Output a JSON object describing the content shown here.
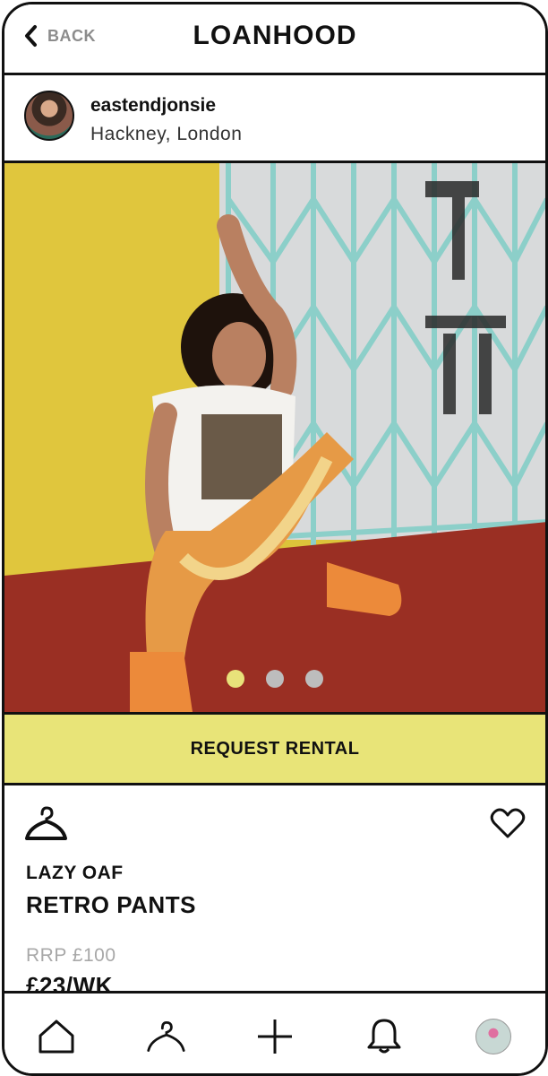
{
  "header": {
    "back_label": "BACK",
    "brand": "LOANHOOD"
  },
  "profile": {
    "username": "eastendjonsie",
    "location": "Hackney, London"
  },
  "gallery": {
    "image_count": 3,
    "active_index": 0
  },
  "actions": {
    "request_label": "REQUEST RENTAL"
  },
  "item": {
    "brand": "LAZY OAF",
    "name": "RETRO PANTS",
    "rrp": "RRP £100",
    "price": "£23/WK"
  },
  "bottom_nav": {
    "items": [
      "home-icon",
      "hanger-icon",
      "plus-icon",
      "bell-icon",
      "profile-avatar"
    ]
  },
  "colors": {
    "accent": "#e8e478",
    "dot_active": "#e8e27a",
    "dot_inactive": "#bdbdbd"
  }
}
